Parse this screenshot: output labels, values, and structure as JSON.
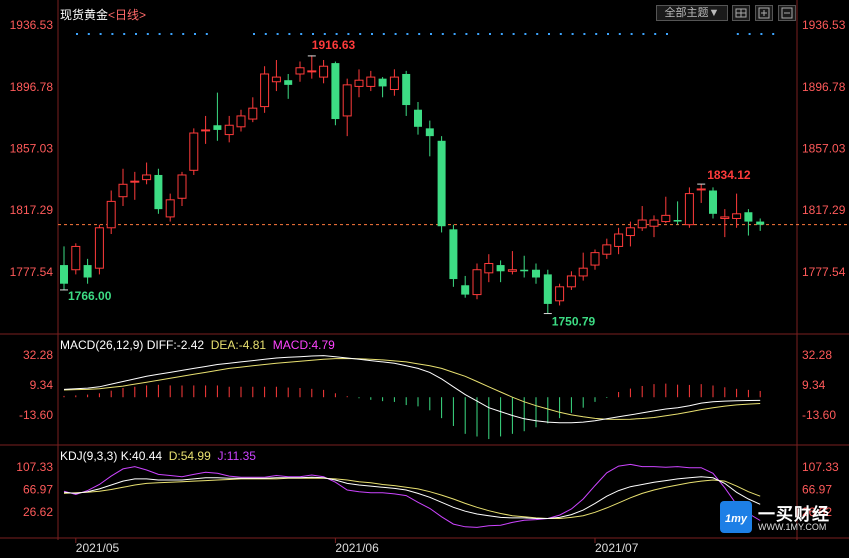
{
  "header": {
    "title": "现货黄金",
    "period": "<日线>",
    "dropdown": "全部主题▼",
    "btn_icons": [
      "grid-icon",
      "zoom-in-icon",
      "zoom-out-icon"
    ]
  },
  "colors": {
    "up": "#ff3b3b",
    "down": "#3ddc84",
    "dif": "#ffffff",
    "dea": "#e8e070",
    "macd": "#ff44ff",
    "k": "#ffffff",
    "d": "#e8e070",
    "j": "#cc44ff",
    "axis_text": "#ff5a5a",
    "dot": "#3da5ff",
    "last_price": "#ff7a3d"
  },
  "chart_data": [
    {
      "type": "candlestick",
      "title": "现货黄金",
      "yticks": [
        "1936.53",
        "1896.78",
        "1857.03",
        "1817.29",
        "1777.54"
      ],
      "ylim": [
        1743,
        1942
      ],
      "xticks": [
        {
          "index": 1,
          "label": "2021/05"
        },
        {
          "index": 23,
          "label": "2021/06"
        },
        {
          "index": 45,
          "label": "2021/07"
        }
      ],
      "annotations": {
        "high": {
          "index": 21,
          "label": "1916.63"
        },
        "low_left": {
          "index": 0,
          "label": "1766.00"
        },
        "low_mid": {
          "index": 41,
          "label": "1750.79"
        },
        "recent_high": {
          "index": 54,
          "label": "1834.12"
        }
      },
      "last_price": 1808,
      "candles": [
        [
          1782,
          1770,
          1794,
          1766
        ],
        [
          1779,
          1794,
          1796,
          1776
        ],
        [
          1782,
          1774,
          1786,
          1770
        ],
        [
          1780,
          1806,
          1808,
          1776
        ],
        [
          1806,
          1823,
          1830,
          1802
        ],
        [
          1826,
          1834,
          1844,
          1820
        ],
        [
          1836,
          1836,
          1842,
          1824
        ],
        [
          1837,
          1840,
          1848,
          1834
        ],
        [
          1840,
          1818,
          1844,
          1815
        ],
        [
          1813,
          1824,
          1828,
          1810
        ],
        [
          1825,
          1840,
          1842,
          1820
        ],
        [
          1843,
          1867,
          1870,
          1840
        ],
        [
          1869,
          1869,
          1878,
          1860
        ],
        [
          1872,
          1869,
          1893,
          1862
        ],
        [
          1866,
          1872,
          1878,
          1861
        ],
        [
          1871,
          1878,
          1882,
          1868
        ],
        [
          1876,
          1883,
          1890,
          1874
        ],
        [
          1884,
          1905,
          1910,
          1880
        ],
        [
          1900,
          1903,
          1914,
          1894
        ],
        [
          1901,
          1898,
          1905,
          1889
        ],
        [
          1905,
          1909,
          1913,
          1900
        ],
        [
          1907,
          1907,
          1917,
          1902
        ],
        [
          1903,
          1910,
          1914,
          1899
        ],
        [
          1912,
          1876,
          1913,
          1872
        ],
        [
          1878,
          1898,
          1902,
          1865
        ],
        [
          1897,
          1901,
          1908,
          1890
        ],
        [
          1897,
          1903,
          1907,
          1894
        ],
        [
          1902,
          1897,
          1903,
          1890
        ],
        [
          1895,
          1903,
          1908,
          1891
        ],
        [
          1905,
          1885,
          1907,
          1878
        ],
        [
          1882,
          1871,
          1887,
          1866
        ],
        [
          1870,
          1865,
          1875,
          1852
        ],
        [
          1862,
          1807,
          1865,
          1803
        ],
        [
          1805,
          1773,
          1808,
          1768
        ],
        [
          1769,
          1763,
          1775,
          1761
        ],
        [
          1763,
          1779,
          1783,
          1760
        ],
        [
          1777,
          1783,
          1789,
          1771
        ],
        [
          1782,
          1778,
          1785,
          1771
        ],
        [
          1778,
          1779,
          1791,
          1776
        ],
        [
          1779,
          1778,
          1788,
          1774
        ],
        [
          1779,
          1774,
          1783,
          1770
        ],
        [
          1776,
          1757,
          1779,
          1751
        ],
        [
          1759,
          1768,
          1770,
          1756
        ],
        [
          1768,
          1775,
          1778,
          1766
        ],
        [
          1775,
          1780,
          1790,
          1772
        ],
        [
          1782,
          1790,
          1792,
          1779
        ],
        [
          1789,
          1795,
          1799,
          1786
        ],
        [
          1794,
          1802,
          1806,
          1789
        ],
        [
          1801,
          1806,
          1810,
          1794
        ],
        [
          1806,
          1811,
          1820,
          1804
        ],
        [
          1807,
          1811,
          1814,
          1800
        ],
        [
          1810,
          1814,
          1826,
          1809
        ],
        [
          1811,
          1810,
          1823,
          1808
        ],
        [
          1808,
          1828,
          1832,
          1806
        ],
        [
          1831,
          1831,
          1834,
          1822
        ],
        [
          1830,
          1815,
          1832,
          1812
        ],
        [
          1812,
          1813,
          1818,
          1800
        ],
        [
          1812,
          1815,
          1828,
          1806
        ],
        [
          1816,
          1810,
          1818,
          1801
        ],
        [
          1810,
          1808,
          1812,
          1804
        ]
      ]
    },
    {
      "type": "line",
      "title": "MACD(26,12,9)",
      "legend": {
        "dif": "DIFF:-2.42",
        "dea": "DEA:-4.81",
        "macd": "MACD:4.79"
      },
      "yticks": [
        "32.28",
        "9.34",
        "-13.60"
      ],
      "ylim": [
        -30,
        38
      ],
      "dif": [
        6,
        6.5,
        7,
        8,
        10,
        12,
        14,
        16,
        17.5,
        19,
        20.5,
        22,
        23.5,
        25,
        26,
        27,
        28,
        29,
        30,
        30.5,
        31,
        31.5,
        31.8,
        31,
        30,
        29,
        28,
        27,
        26,
        24,
        22,
        19,
        14,
        8,
        2,
        -3,
        -8,
        -11,
        -14,
        -16.5,
        -18,
        -19,
        -19.5,
        -19.5,
        -19,
        -18,
        -16.5,
        -15,
        -13.5,
        -12,
        -10.5,
        -9,
        -8,
        -6.5,
        -4.5,
        -3.5,
        -3,
        -2.7,
        -2.5,
        -2.42
      ],
      "dea": [
        5.5,
        5.8,
        6,
        6.5,
        7.5,
        8.5,
        10,
        11.5,
        13,
        14.5,
        16,
        17.5,
        19,
        20.5,
        22,
        23,
        24,
        25,
        26,
        26.8,
        27.5,
        28.3,
        29,
        29.5,
        29.6,
        29.4,
        29,
        28.5,
        27.8,
        27,
        25.5,
        24,
        22,
        19,
        16,
        12,
        8,
        4,
        0,
        -3.5,
        -6.5,
        -9,
        -11.5,
        -13.5,
        -15,
        -16.2,
        -16.8,
        -17,
        -16.8,
        -16.3,
        -15.5,
        -14.2,
        -12.8,
        -11.2,
        -9.5,
        -8,
        -6.8,
        -5.9,
        -5.3,
        -4.81
      ],
      "macd": [
        1,
        1.4,
        2,
        3,
        5,
        7,
        8,
        9,
        9.5,
        9,
        9,
        9,
        9,
        9,
        8,
        8,
        8,
        8,
        8,
        7.4,
        7,
        6.4,
        5.6,
        3,
        0.8,
        -0.8,
        -2,
        -3,
        -3.6,
        -6,
        -7,
        -10,
        -16,
        -22,
        -28,
        -30,
        -32,
        -30,
        -28,
        -26,
        -23,
        -20,
        -16,
        -12,
        -8,
        -3.6,
        -0.6,
        4,
        6.6,
        8.6,
        10,
        10.4,
        9.6,
        9.4,
        10,
        9,
        7.6,
        6.4,
        5.6,
        4.79
      ]
    },
    {
      "type": "line",
      "title": "KDJ(9,3,3)",
      "legend": {
        "k": "K:40.44",
        "d": "D:54.99",
        "j": "J:11.35"
      },
      "yticks": [
        "107.33",
        "66.97",
        "26.62"
      ],
      "ylim": [
        -5,
        125
      ],
      "k": [
        62,
        60,
        63,
        68,
        75,
        82,
        86,
        86,
        84,
        84,
        84,
        86,
        88,
        88,
        87,
        87,
        87,
        87,
        88,
        88,
        88,
        89,
        88,
        84,
        78,
        75,
        73,
        71,
        69,
        66,
        60,
        53,
        44,
        35,
        28,
        23,
        20,
        17,
        16,
        16,
        15,
        15,
        17,
        22,
        30,
        42,
        55,
        65,
        72,
        76,
        80,
        83,
        86,
        88,
        90,
        88,
        78,
        62,
        50,
        40.44
      ],
      "d": [
        60,
        61,
        62,
        64,
        67,
        71,
        75,
        78,
        79,
        80,
        81,
        82,
        83,
        84,
        85,
        86,
        86,
        86,
        86,
        87,
        87,
        87,
        87,
        86,
        84,
        81,
        79,
        76,
        74,
        71,
        68,
        63,
        57,
        50,
        42,
        35,
        29,
        24,
        20,
        18,
        16,
        15,
        15,
        17,
        20,
        26,
        34,
        43,
        52,
        60,
        66,
        71,
        75,
        79,
        82,
        84,
        82,
        73,
        63,
        54.99
      ],
      "j": [
        64,
        58,
        65,
        76,
        91,
        104,
        108,
        102,
        94,
        92,
        90,
        94,
        98,
        96,
        91,
        89,
        89,
        89,
        92,
        90,
        90,
        93,
        90,
        80,
        66,
        63,
        61,
        61,
        59,
        56,
        44,
        33,
        18,
        5,
        0,
        -1,
        2,
        3,
        8,
        12,
        13,
        15,
        21,
        32,
        50,
        74,
        97,
        109,
        112,
        108,
        108,
        107,
        108,
        106,
        106,
        96,
        70,
        40,
        24,
        11.35
      ]
    }
  ],
  "logo": {
    "brand": "一买财经",
    "site": "WWW.1MY.COM",
    "badge": "1my"
  }
}
